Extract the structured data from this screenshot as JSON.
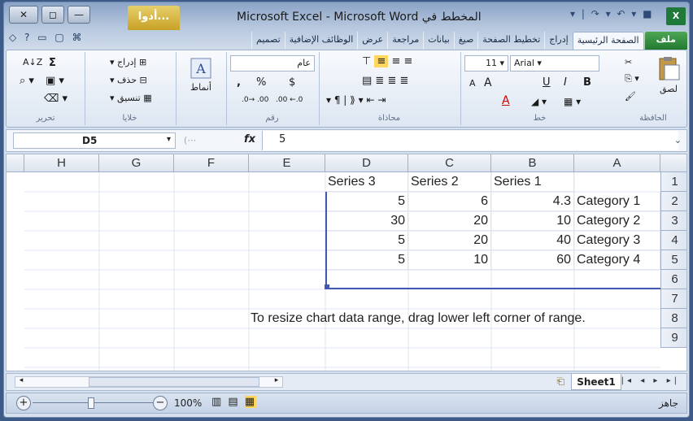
{
  "window": {
    "title": "Microsoft Excel - Microsoft Word المخطط في",
    "context_tab": "أدوا...",
    "close_glyph": "✕",
    "restore_glyph": "◻",
    "minimize_glyph": "—",
    "app_icon": "X"
  },
  "qat": {
    "glyphs": "▾ | ↷ ▾ ↶ ▾ ■"
  },
  "tabs": [
    "ملف",
    "الصفحة الرئيسية",
    "إدراج",
    "تخطيط الصفحة",
    "صيغ",
    "بيانات",
    "مراجعة",
    "عرض",
    "الوظائف الإضافية",
    "تصميم"
  ],
  "help_glyphs": "◇ ? ▭ ▢ ⌘",
  "ribbon": {
    "clipboard": {
      "label": "الحافظة",
      "paste": "لصق"
    },
    "font": {
      "label": "خط",
      "name": "Arial",
      "size": "11",
      "bold": "B",
      "italic": "I",
      "underline": "U",
      "grow": "A",
      "shrink": "A",
      "color_a": "A"
    },
    "alignment": {
      "label": "محاذاة"
    },
    "number": {
      "label": "رقم",
      "format": "عام",
      "currency": "$",
      "percent": "%",
      "comma": ",",
      "inc_dec": ".00 ←.0",
      "dec_dec": ".0→ .00"
    },
    "styles": {
      "label": "أنماط"
    },
    "cells": {
      "label": "خلايا",
      "insert": "إدراج",
      "delete": "حذف",
      "format": "تنسيق"
    },
    "editing": {
      "label": "تحرير",
      "sum": "Σ",
      "sort": "A↓Z"
    }
  },
  "formula_bar": {
    "name_box": "D5",
    "fx": "fx",
    "value": "5"
  },
  "columns": [
    "H",
    "G",
    "F",
    "E",
    "D",
    "C",
    "B",
    "A"
  ],
  "rows": [
    "1",
    "2",
    "3",
    "4",
    "5",
    "6",
    "7",
    "8",
    "9"
  ],
  "cells": {
    "header": [
      "Series 3",
      "Series 2",
      "Series 1",
      ""
    ],
    "data": [
      {
        "d": "5",
        "c": "6",
        "b": "4.3",
        "a": "Category 1"
      },
      {
        "d": "30",
        "c": "20",
        "b": "10",
        "a": "Category 2"
      },
      {
        "d": "5",
        "c": "20",
        "b": "40",
        "a": "Category 3"
      },
      {
        "d": "5",
        "c": "10",
        "b": "60",
        "a": "Category 4"
      }
    ],
    "note": "To resize chart data range, drag lower left corner of range."
  },
  "sheet_tab": "Sheet1",
  "status": {
    "ready": "جاهز",
    "zoom": "100%"
  },
  "colors": {
    "range_border": "#4358b0",
    "file_tab": "#217a30",
    "context_tab": "#c9a226"
  }
}
